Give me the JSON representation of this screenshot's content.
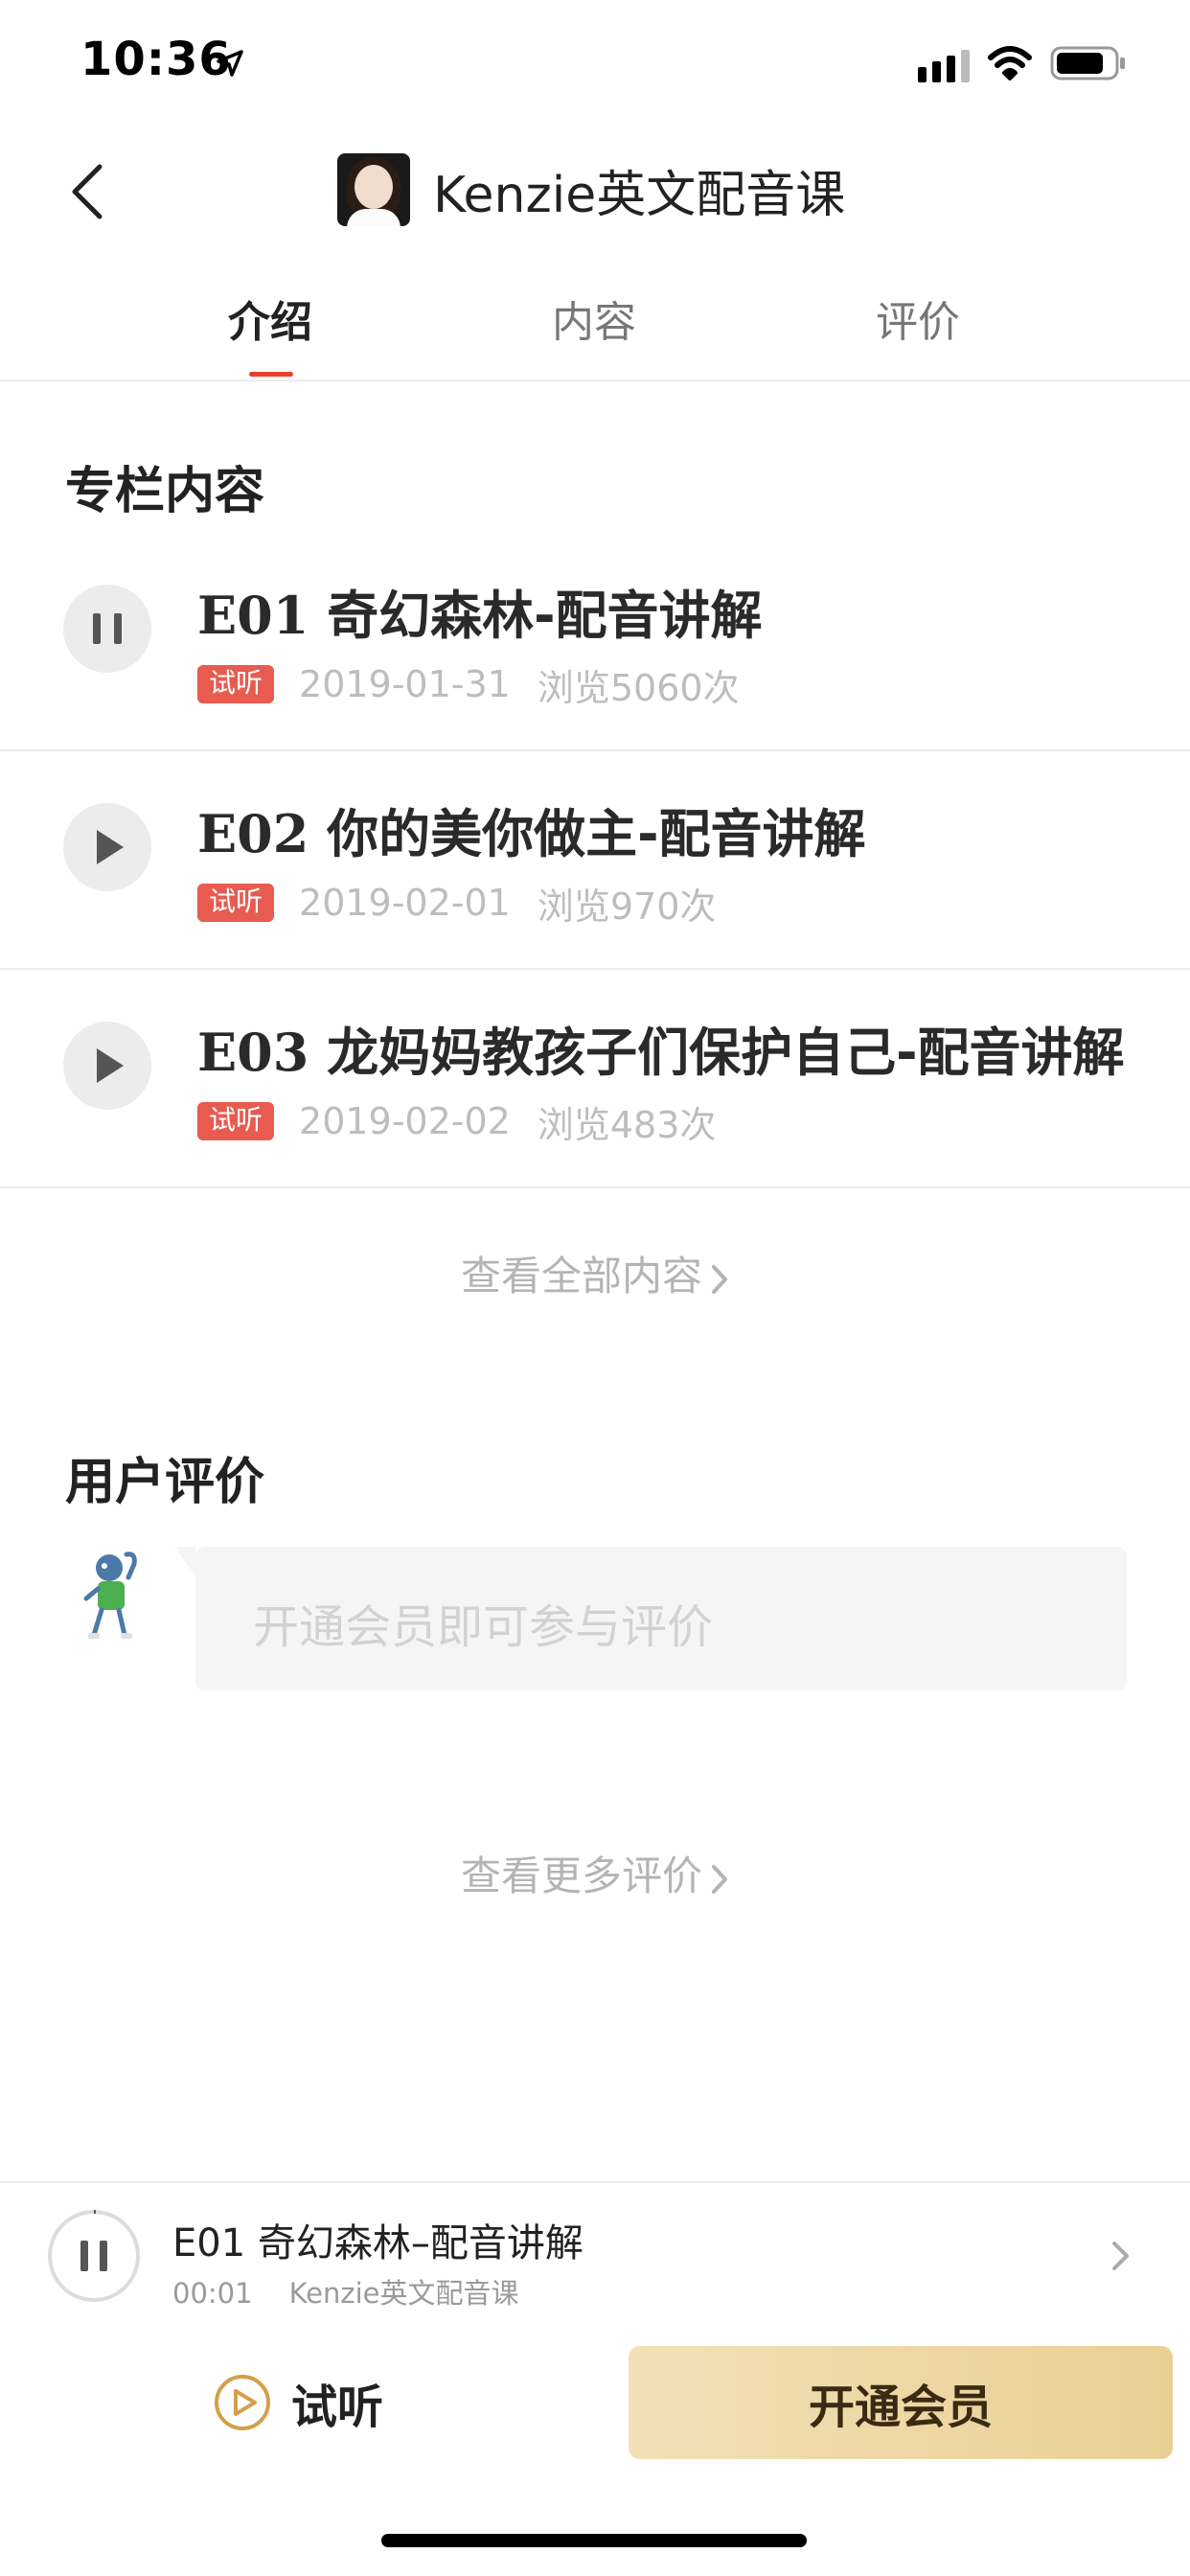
{
  "status_bar": {
    "time": "10:36"
  },
  "header": {
    "title": "Kenzie英文配音课"
  },
  "tabs": [
    {
      "label": "介绍",
      "active": true
    },
    {
      "label": "内容",
      "active": false
    },
    {
      "label": "评价",
      "active": false
    }
  ],
  "content_section": {
    "heading": "专栏内容",
    "episodes": [
      {
        "code": "E01",
        "title": "奇幻森林-配音讲解",
        "badge": "试听",
        "date": "2019-01-31",
        "views": "浏览5060次",
        "state": "playing"
      },
      {
        "code": "E02",
        "title": "你的美你做主-配音讲解",
        "badge": "试听",
        "date": "2019-02-01",
        "views": "浏览970次",
        "state": "paused"
      },
      {
        "code": "E03",
        "title": "龙妈妈教孩子们保护自己-配音讲解",
        "badge": "试听",
        "date": "2019-02-02",
        "views": "浏览483次",
        "state": "paused"
      }
    ],
    "view_all": "查看全部内容"
  },
  "review_section": {
    "heading": "用户评价",
    "placeholder": "开通会员即可参与评价",
    "view_more": "查看更多评价"
  },
  "mini_player": {
    "title": "E01 奇幻森林–配音讲解",
    "time": "00:01",
    "course": "Kenzie英文配音课"
  },
  "bottom_bar": {
    "trial_label": "试听",
    "join_label": "开通会员"
  },
  "colors": {
    "accent_red": "#e8412f",
    "badge_red": "#e85b50",
    "gold_button": "#e9cf94"
  }
}
